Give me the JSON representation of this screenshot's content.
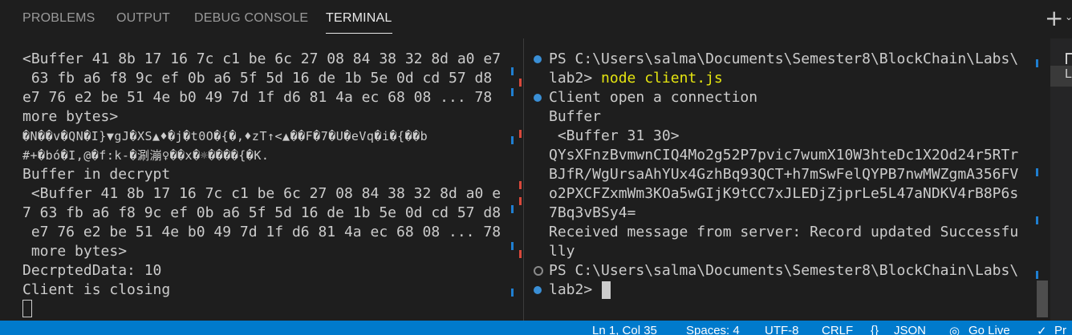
{
  "panel": {
    "tabs": [
      "PROBLEMS",
      "OUTPUT",
      "DEBUG CONSOLE",
      "TERMINAL"
    ],
    "active_tab": "TERMINAL",
    "new_terminal_icon": "plus-icon",
    "dropdown_icon": "chevron-down-icon"
  },
  "terminal_left": {
    "lines": [
      "<Buffer 41 8b 17 16 7c c1 be 6c 27 08 84 38 32 8d a0 e7",
      " 63 fb a6 f8 9c ef 0b a6 5f 5d 16 de 1b 5e 0d cd 57 d8",
      "e7 76 e2 be 51 4e b0 49 7d 1f d6 81 4a ec 68 08 ... 78",
      "more bytes>",
      "�N��v�QN�I}▼gJ�XS▲♦�j�t0O�{�,♦zT↑<▲��F�7�U�eVq�i�{��b",
      "#+�bó�I,@�f:k-�涮漰♀��x�☼����{�K.",
      "Buffer in decrypt",
      " <Buffer 41 8b 17 16 7c c1 be 6c 27 08 84 38 32 8d a0 e",
      "7 63 fb a6 f8 9c ef 0b a6 5f 5d 16 de 1b 5e 0d cd 57 d8",
      " e7 76 e2 be 51 4e b0 49 7d 1f d6 81 4a ec 68 08 ... 78",
      " more bytes>",
      "DecrptedData: 10",
      "Client is closing"
    ]
  },
  "terminal_right": {
    "prompt_path": "PS C:\\Users\\salma\\Documents\\Semester8\\BlockChain\\Labs\\",
    "prompt_end": "lab2> ",
    "command": "node client.js",
    "lines": [
      "Client open a connection",
      "Buffer",
      " <Buffer 31 30>",
      "QYsXFnzBvmwnCIQ4Mo2g52P7pvic7wumX10W3hteDc1X2Od24r5RTr",
      "BJfR/WgUrsaAhYUx4GzhBq93QCT+h7mSwFelQYPB7nwMWZgmA356FV",
      "o2PXCFZxmWm3KOa5wGIjK9tCC7xJLEDjZjprLe5L47aNDKV4rB8P6s",
      "7Bq3vBSy4=",
      "Received message from server: Record updated Successfu",
      "lly"
    ],
    "final_prompt_path": "PS C:\\Users\\salma\\Documents\\Semester8\\BlockChain\\Labs\\",
    "final_prompt_end": "lab2> "
  },
  "minimap": {
    "label": "L"
  },
  "statusbar": {
    "position": "Ln 1, Col 35",
    "spaces": "Spaces: 4",
    "encoding": "UTF-8",
    "eol": "CRLF",
    "language": "JSON",
    "golive": "Go Live",
    "lang_icon": "braces-icon",
    "golive_icon": "broadcast-icon",
    "check_icon": "check-icon",
    "extra": "Pr"
  },
  "colors": {
    "background": "#1e1e1e",
    "status_bar": "#007acc",
    "command": "#e5e510",
    "decoration_dot": "#3a8fd6"
  }
}
